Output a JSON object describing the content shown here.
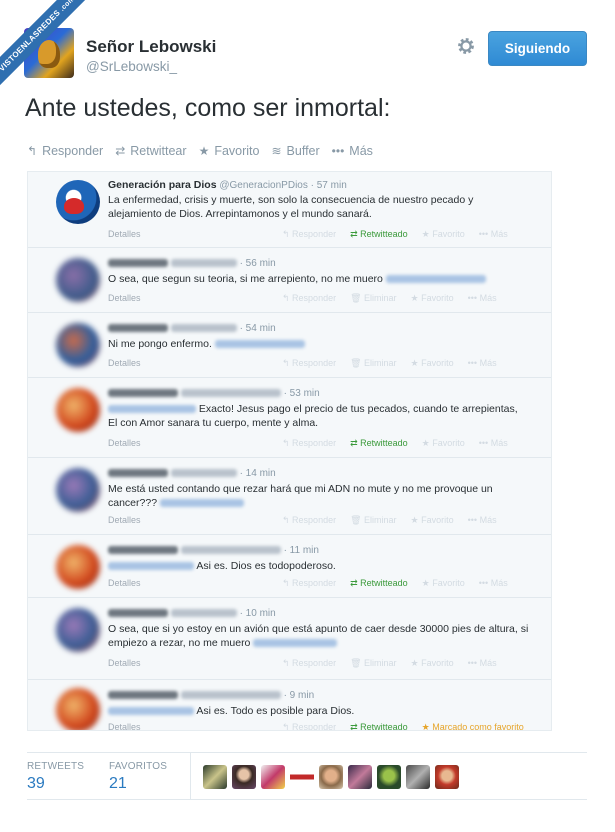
{
  "watermark": "VISTOENLASREDES.com",
  "author": {
    "name": "Señor Lebowski",
    "handle": "@SrLebowski_",
    "avatar_icon": "avatar-icon"
  },
  "header": {
    "follow_label": "Siguiendo",
    "settings_icon": "gear-icon"
  },
  "tweet": {
    "text": "Ante ustedes, como ser inmortal:"
  },
  "actions": [
    {
      "label": "Responder",
      "icon": "reply-icon"
    },
    {
      "label": "Retwittear",
      "icon": "retweet-icon"
    },
    {
      "label": "Favorito",
      "icon": "star-icon"
    },
    {
      "label": "Buffer",
      "icon": "buffer-icon"
    },
    {
      "label": "Más",
      "icon": "more-icon"
    }
  ],
  "conversation": {
    "first": {
      "name": "Generación para Dios",
      "handle": "@GeneracionPDios",
      "time": "· 57 min",
      "text": "La enfermedad, crisis y muerte, son solo la consecuencia de nuestro pecado y alejamiento de Dios. Arrepintamonos y el mundo sanará."
    },
    "replies": [
      {
        "time": "· 56 min",
        "text": "O sea, que segun su teoria, si me arrepiento, no me muero"
      },
      {
        "time": "· 54 min",
        "text": "Ni me pongo enfermo."
      },
      {
        "time": "· 53 min",
        "text": "Exacto! Jesus pago el precio de tus pecados, cuando te arrepientas, El con Amor sanara tu cuerpo, mente y alma."
      },
      {
        "time": "· 14 min",
        "text": "Me está usted contando que rezar hará que mi ADN no mute y no me provoque un cancer???"
      },
      {
        "time": "· 11 min",
        "text": "Asi es. Dios es todopoderoso."
      },
      {
        "time": "· 10 min",
        "text": "O sea, que si yo estoy en un avión que está apunto de caer desde 30000 pies de altura, si empiezo a rezar, no me muero"
      },
      {
        "time": "· 9 min",
        "text": "Asi es. Todo es posible para Dios."
      }
    ],
    "labels": {
      "details": "Detalles",
      "reply": "Responder",
      "delete": "Eliminar",
      "retweeted": "Retwitteado",
      "favorite": "Favorito",
      "more": "Más",
      "marked_favorite": "Marcado como favorito"
    }
  },
  "stats": {
    "retweets_label": "RETWEETS",
    "retweets_value": "39",
    "favorites_label": "FAVORITOS",
    "favorites_value": "21"
  },
  "colors": {
    "accent": "#2a7ac0",
    "follow_button": "#2f8ad4",
    "retweet_green": "#3b9a3b",
    "favorite_gold": "#e6a52a"
  }
}
